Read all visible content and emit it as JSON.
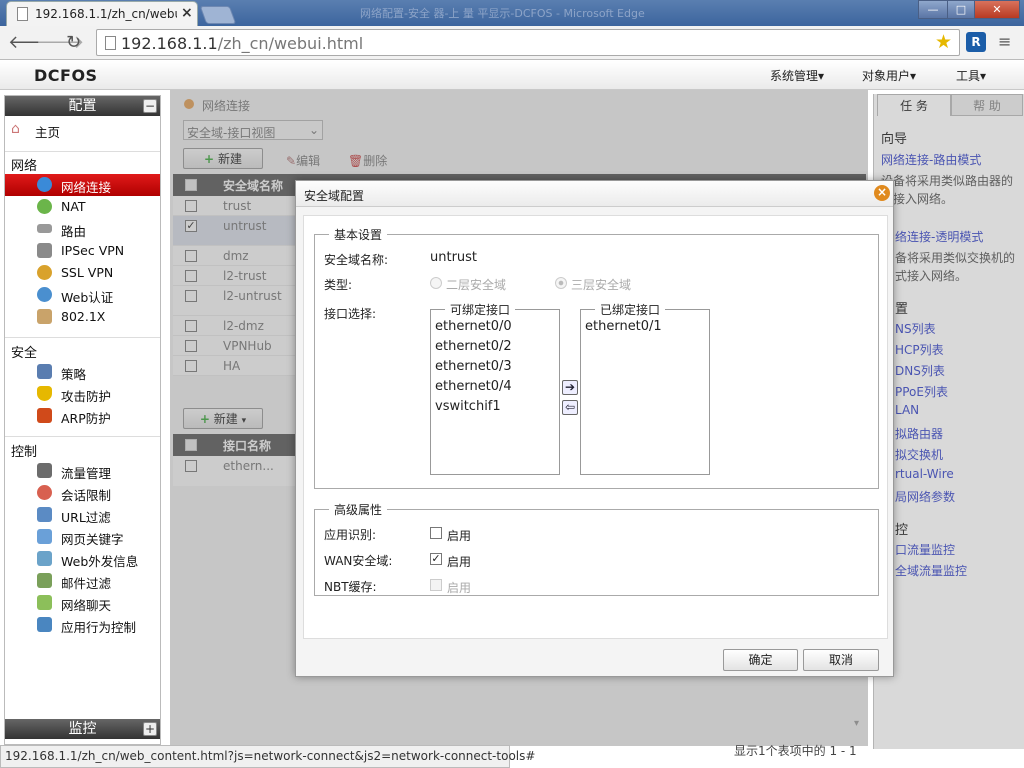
{
  "browser": {
    "tab_title": "192.168.1.1/zh_cn/webu",
    "window_title": "网络配置-安全 器-上 量 平显示-DCFOS - Microsoft Edge",
    "url_host": "192.168.1.1",
    "url_path": "/zh_cn/webui.html",
    "minimize": "—",
    "maximize": "□",
    "close": "✕",
    "ext_label": "R"
  },
  "app": {
    "logo": "DCFOS",
    "menu": [
      "系统管理▾",
      "对象用户▾",
      "工具▾"
    ]
  },
  "sidebar": {
    "config_title": "配置",
    "config_toggle": "−",
    "home": "主页",
    "net_section": "网络",
    "net_items": [
      "网络连接",
      "NAT",
      "路由",
      "IPSec VPN",
      "SSL VPN",
      "Web认证",
      "802.1X"
    ],
    "sec_section": "安全",
    "sec_items": [
      "策略",
      "攻击防护",
      "ARP防护"
    ],
    "ctl_section": "控制",
    "ctl_items": [
      "流量管理",
      "会话限制",
      "URL过滤",
      "网页关键字",
      "Web外发信息",
      "邮件过滤",
      "网络聊天",
      "应用行为控制"
    ],
    "monitor_title": "监控",
    "monitor_toggle": "+"
  },
  "main": {
    "breadcrumb": "网络连接",
    "view_select": "安全域-接口视图",
    "new_btn": "新建",
    "edit_btn": "编辑",
    "delete_btn": "删除",
    "zone_col": "安全域名称",
    "zones": [
      "trust",
      "untrust",
      "dmz",
      "l2-trust",
      "l2-untrust",
      "l2-dmz",
      "VPNHub",
      "HA"
    ],
    "new_btn2": "新建",
    "iface_col": "接口名称",
    "iface_row": "ethern...",
    "page_info": "显示1个表项中的 1 - 1"
  },
  "right": {
    "tab_task": "任 务",
    "tab_help": "帮 助",
    "guide": "向导",
    "link_route": "网络连接-路由模式",
    "desc_route1": "设备将采用类似路由器的",
    "desc_route2": "式接入网络。",
    "link_trans": "络连接-透明模式",
    "desc_trans1": "备将采用类似交换机的",
    "desc_trans2": "式接入网络。",
    "cfg_head": "置",
    "cfg_links": [
      "NS列表",
      "HCP列表",
      "DNS列表",
      "PPoE列表",
      "LAN",
      "拟路由器",
      "拟交换机",
      "rtual-Wire",
      "局网络参数"
    ],
    "mon_head": "控",
    "mon_links": [
      "口流量监控",
      "全域流量监控"
    ]
  },
  "status_url": "192.168.1.1/zh_cn/web_content.html?js=network-connect&js2=network-connect-tools#",
  "dialog": {
    "title": "安全域配置",
    "basic_legend": "基本设置",
    "name_label": "安全域名称:",
    "name_value": "untrust",
    "type_label": "类型:",
    "type_l2": "二层安全域",
    "type_l3": "三层安全域",
    "iface_label": "接口选择:",
    "bindable_legend": "可绑定接口",
    "bindable": [
      "ethernet0/0",
      "ethernet0/2",
      "ethernet0/3",
      "ethernet0/4",
      "vswitchif1"
    ],
    "bound_legend": "已绑定接口",
    "bound": [
      "ethernet0/1"
    ],
    "adv_legend": "高级属性",
    "app_label": "应用识别:",
    "wan_label": "WAN安全域:",
    "nbt_label": "NBT缓存:",
    "enable": "启用",
    "app_checked": false,
    "wan_checked": true,
    "nbt_checked": false,
    "ok": "确定",
    "cancel": "取消"
  }
}
